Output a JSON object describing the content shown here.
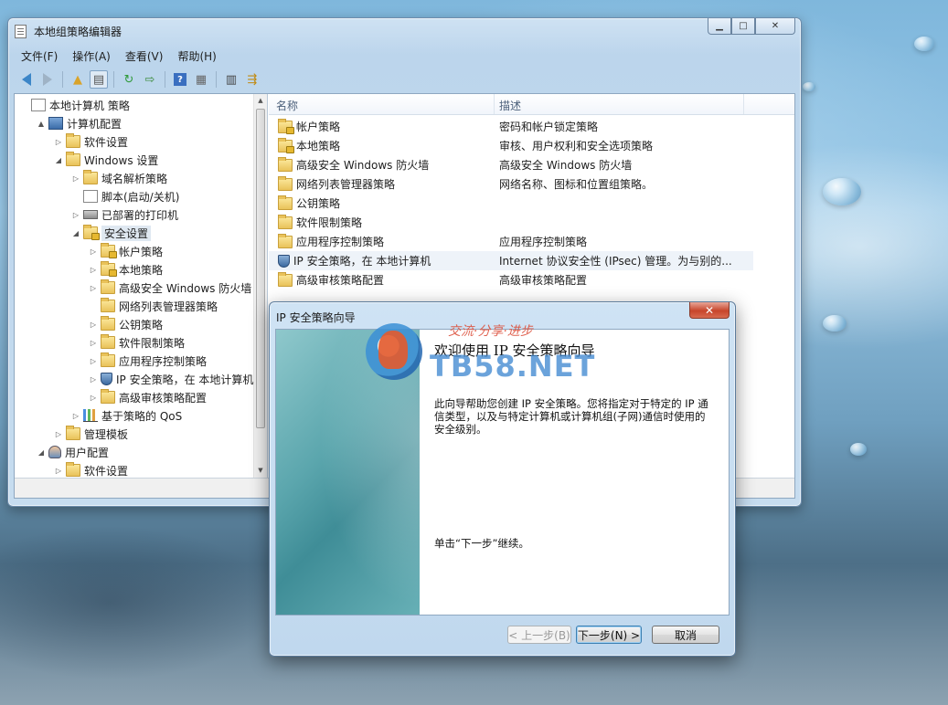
{
  "main_window": {
    "title": "本地组策略编辑器",
    "menu": [
      "文件(F)",
      "操作(A)",
      "查看(V)",
      "帮助(H)"
    ],
    "toolbar_icons": [
      "back-icon",
      "forward-icon",
      "up-folder-icon",
      "show-hide-tree-icon",
      "refresh-icon",
      "export-list-icon",
      "help-icon",
      "properties-icon",
      "policy-icon",
      "filter-icon"
    ],
    "tree": [
      {
        "label": "本地计算机 策略",
        "icon": "doc",
        "level": 0,
        "toggle": ""
      },
      {
        "label": "计算机配置",
        "icon": "computer",
        "level": 1,
        "toggle": "▲"
      },
      {
        "label": "软件设置",
        "icon": "folder",
        "level": 2,
        "toggle": "▷"
      },
      {
        "label": "Windows 设置",
        "icon": "folder",
        "level": 2,
        "toggle": "◢"
      },
      {
        "label": "域名解析策略",
        "icon": "folder",
        "level": 3,
        "toggle": "▷"
      },
      {
        "label": "脚本(启动/关机)",
        "icon": "doc",
        "level": 3,
        "toggle": ""
      },
      {
        "label": "已部署的打印机",
        "icon": "printer",
        "level": 3,
        "toggle": "▷"
      },
      {
        "label": "安全设置",
        "icon": "folder-lock",
        "level": 3,
        "toggle": "◢",
        "selected": true
      },
      {
        "label": "帐户策略",
        "icon": "folder-lock",
        "level": 4,
        "toggle": "▷"
      },
      {
        "label": "本地策略",
        "icon": "folder-lock",
        "level": 4,
        "toggle": "▷"
      },
      {
        "label": "高级安全 Windows 防火墙",
        "icon": "folder",
        "level": 4,
        "toggle": "▷"
      },
      {
        "label": "网络列表管理器策略",
        "icon": "folder",
        "level": 4,
        "toggle": ""
      },
      {
        "label": "公钥策略",
        "icon": "folder",
        "level": 4,
        "toggle": "▷"
      },
      {
        "label": "软件限制策略",
        "icon": "folder",
        "level": 4,
        "toggle": "▷"
      },
      {
        "label": "应用程序控制策略",
        "icon": "folder",
        "level": 4,
        "toggle": "▷"
      },
      {
        "label": "IP 安全策略，在 本地计算机",
        "icon": "shield",
        "level": 4,
        "toggle": "▷"
      },
      {
        "label": "高级审核策略配置",
        "icon": "folder",
        "level": 4,
        "toggle": "▷"
      },
      {
        "label": "基于策略的 QoS",
        "icon": "chart",
        "level": 3,
        "toggle": "▷"
      },
      {
        "label": "管理模板",
        "icon": "folder",
        "level": 2,
        "toggle": "▷"
      },
      {
        "label": "用户配置",
        "icon": "user",
        "level": 1,
        "toggle": "◢"
      },
      {
        "label": "软件设置",
        "icon": "folder",
        "level": 2,
        "toggle": "▷"
      }
    ],
    "list_headers": {
      "name": "名称",
      "desc": "描述"
    },
    "list_rows": [
      {
        "name": "帐户策略",
        "desc": "密码和帐户锁定策略",
        "icon": "folder-lock"
      },
      {
        "name": "本地策略",
        "desc": "审核、用户权利和安全选项策略",
        "icon": "folder-lock"
      },
      {
        "name": "高级安全 Windows 防火墙",
        "desc": "高级安全 Windows 防火墙",
        "icon": "folder"
      },
      {
        "name": "网络列表管理器策略",
        "desc": "网络名称、图标和位置组策略。",
        "icon": "folder"
      },
      {
        "name": "公钥策略",
        "desc": "",
        "icon": "folder"
      },
      {
        "name": "软件限制策略",
        "desc": "",
        "icon": "folder"
      },
      {
        "name": "应用程序控制策略",
        "desc": "应用程序控制策略",
        "icon": "folder"
      },
      {
        "name": "IP 安全策略，在 本地计算机",
        "desc": "Internet 协议安全性 (IPsec) 管理。为与别的...",
        "icon": "shield",
        "hover": true
      },
      {
        "name": "高级审核策略配置",
        "desc": "高级审核策略配置",
        "icon": "folder"
      }
    ]
  },
  "dialog": {
    "title": "IP 安全策略向导",
    "heading": "欢迎使用 IP 安全策略向导",
    "body": "此向导帮助您创建 IP 安全策略。您将指定对于特定的 IP 通信类型，以及与特定计算机或计算机组(子网)通信时使用的安全级别。",
    "hint": "单击“下一步”继续。",
    "buttons": {
      "back": "< 上一步(B)",
      "next": "下一步(N) >",
      "cancel": "取消"
    }
  },
  "watermark": {
    "slogan": "交流·分享·进步",
    "site": "TB58.NET"
  }
}
